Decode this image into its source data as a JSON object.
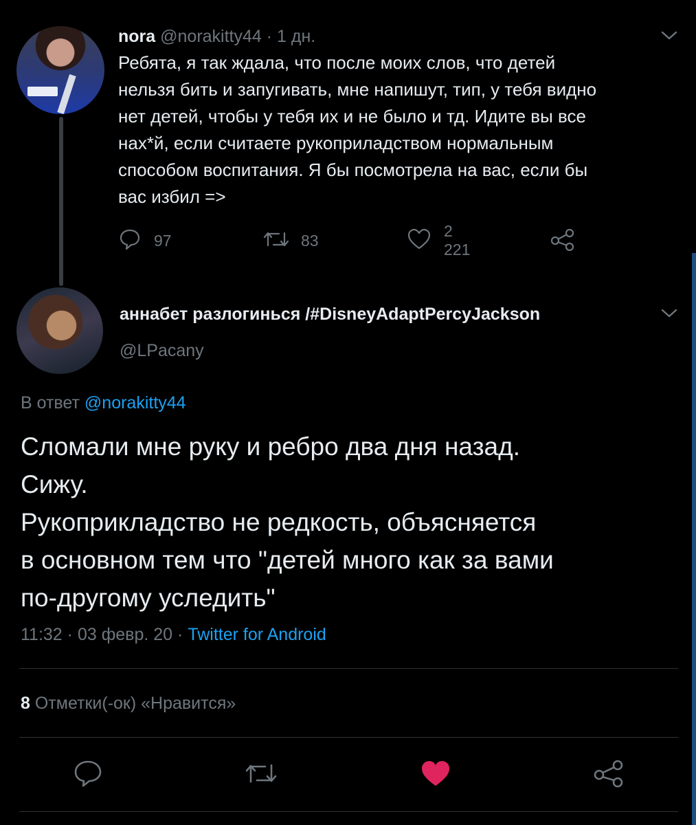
{
  "parent_tweet": {
    "display_name": "nora",
    "handle": "@norakitty44",
    "separator": "·",
    "time_ago": "1 дн.",
    "text": "Ребята, я так ждала, что после моих слов, что детей\nнельзя бить и запугивать, мне напишут, тип, у тебя видно\nнет детей, чтобы у тебя их и не было и тд. Идите вы все\nнах*й, если считаете рукоприладством нормальным\nспособом воспитания. Я бы посмотрела на вас, если бы\nвас избил =>",
    "replies": "97",
    "retweets": "83",
    "likes": "2 221",
    "icons": [
      "reply-icon",
      "retweet-icon",
      "like-icon",
      "share-icon",
      "chevron-down-icon"
    ]
  },
  "main_tweet": {
    "display_name": "аннабет разлогинься /#DisneyAdaptPercyJackson",
    "handle": "@LPacany",
    "reply_prefix": "В ответ",
    "reply_to": "@norakitty44",
    "text": "Сломали мне руку и ребро два дня назад.\nСижу.\nРукоприкладство не редкость, объясняется\nв основном тем что \"детей много как за вами\nпо-другому уследить\"",
    "time": "11:32",
    "date": "03 февр. 20",
    "separator": "·",
    "source": "Twitter for Android",
    "like_count": "8",
    "like_label": "Отметки(-ок) «Нравится»",
    "liked": true
  },
  "colors": {
    "background": "#000000",
    "text": "#e6ecf0",
    "muted": "#6e767d",
    "link": "#1da1f2",
    "like_active": "#e0245e",
    "divider": "#2f3336",
    "thread_line": "#3a3d41"
  }
}
